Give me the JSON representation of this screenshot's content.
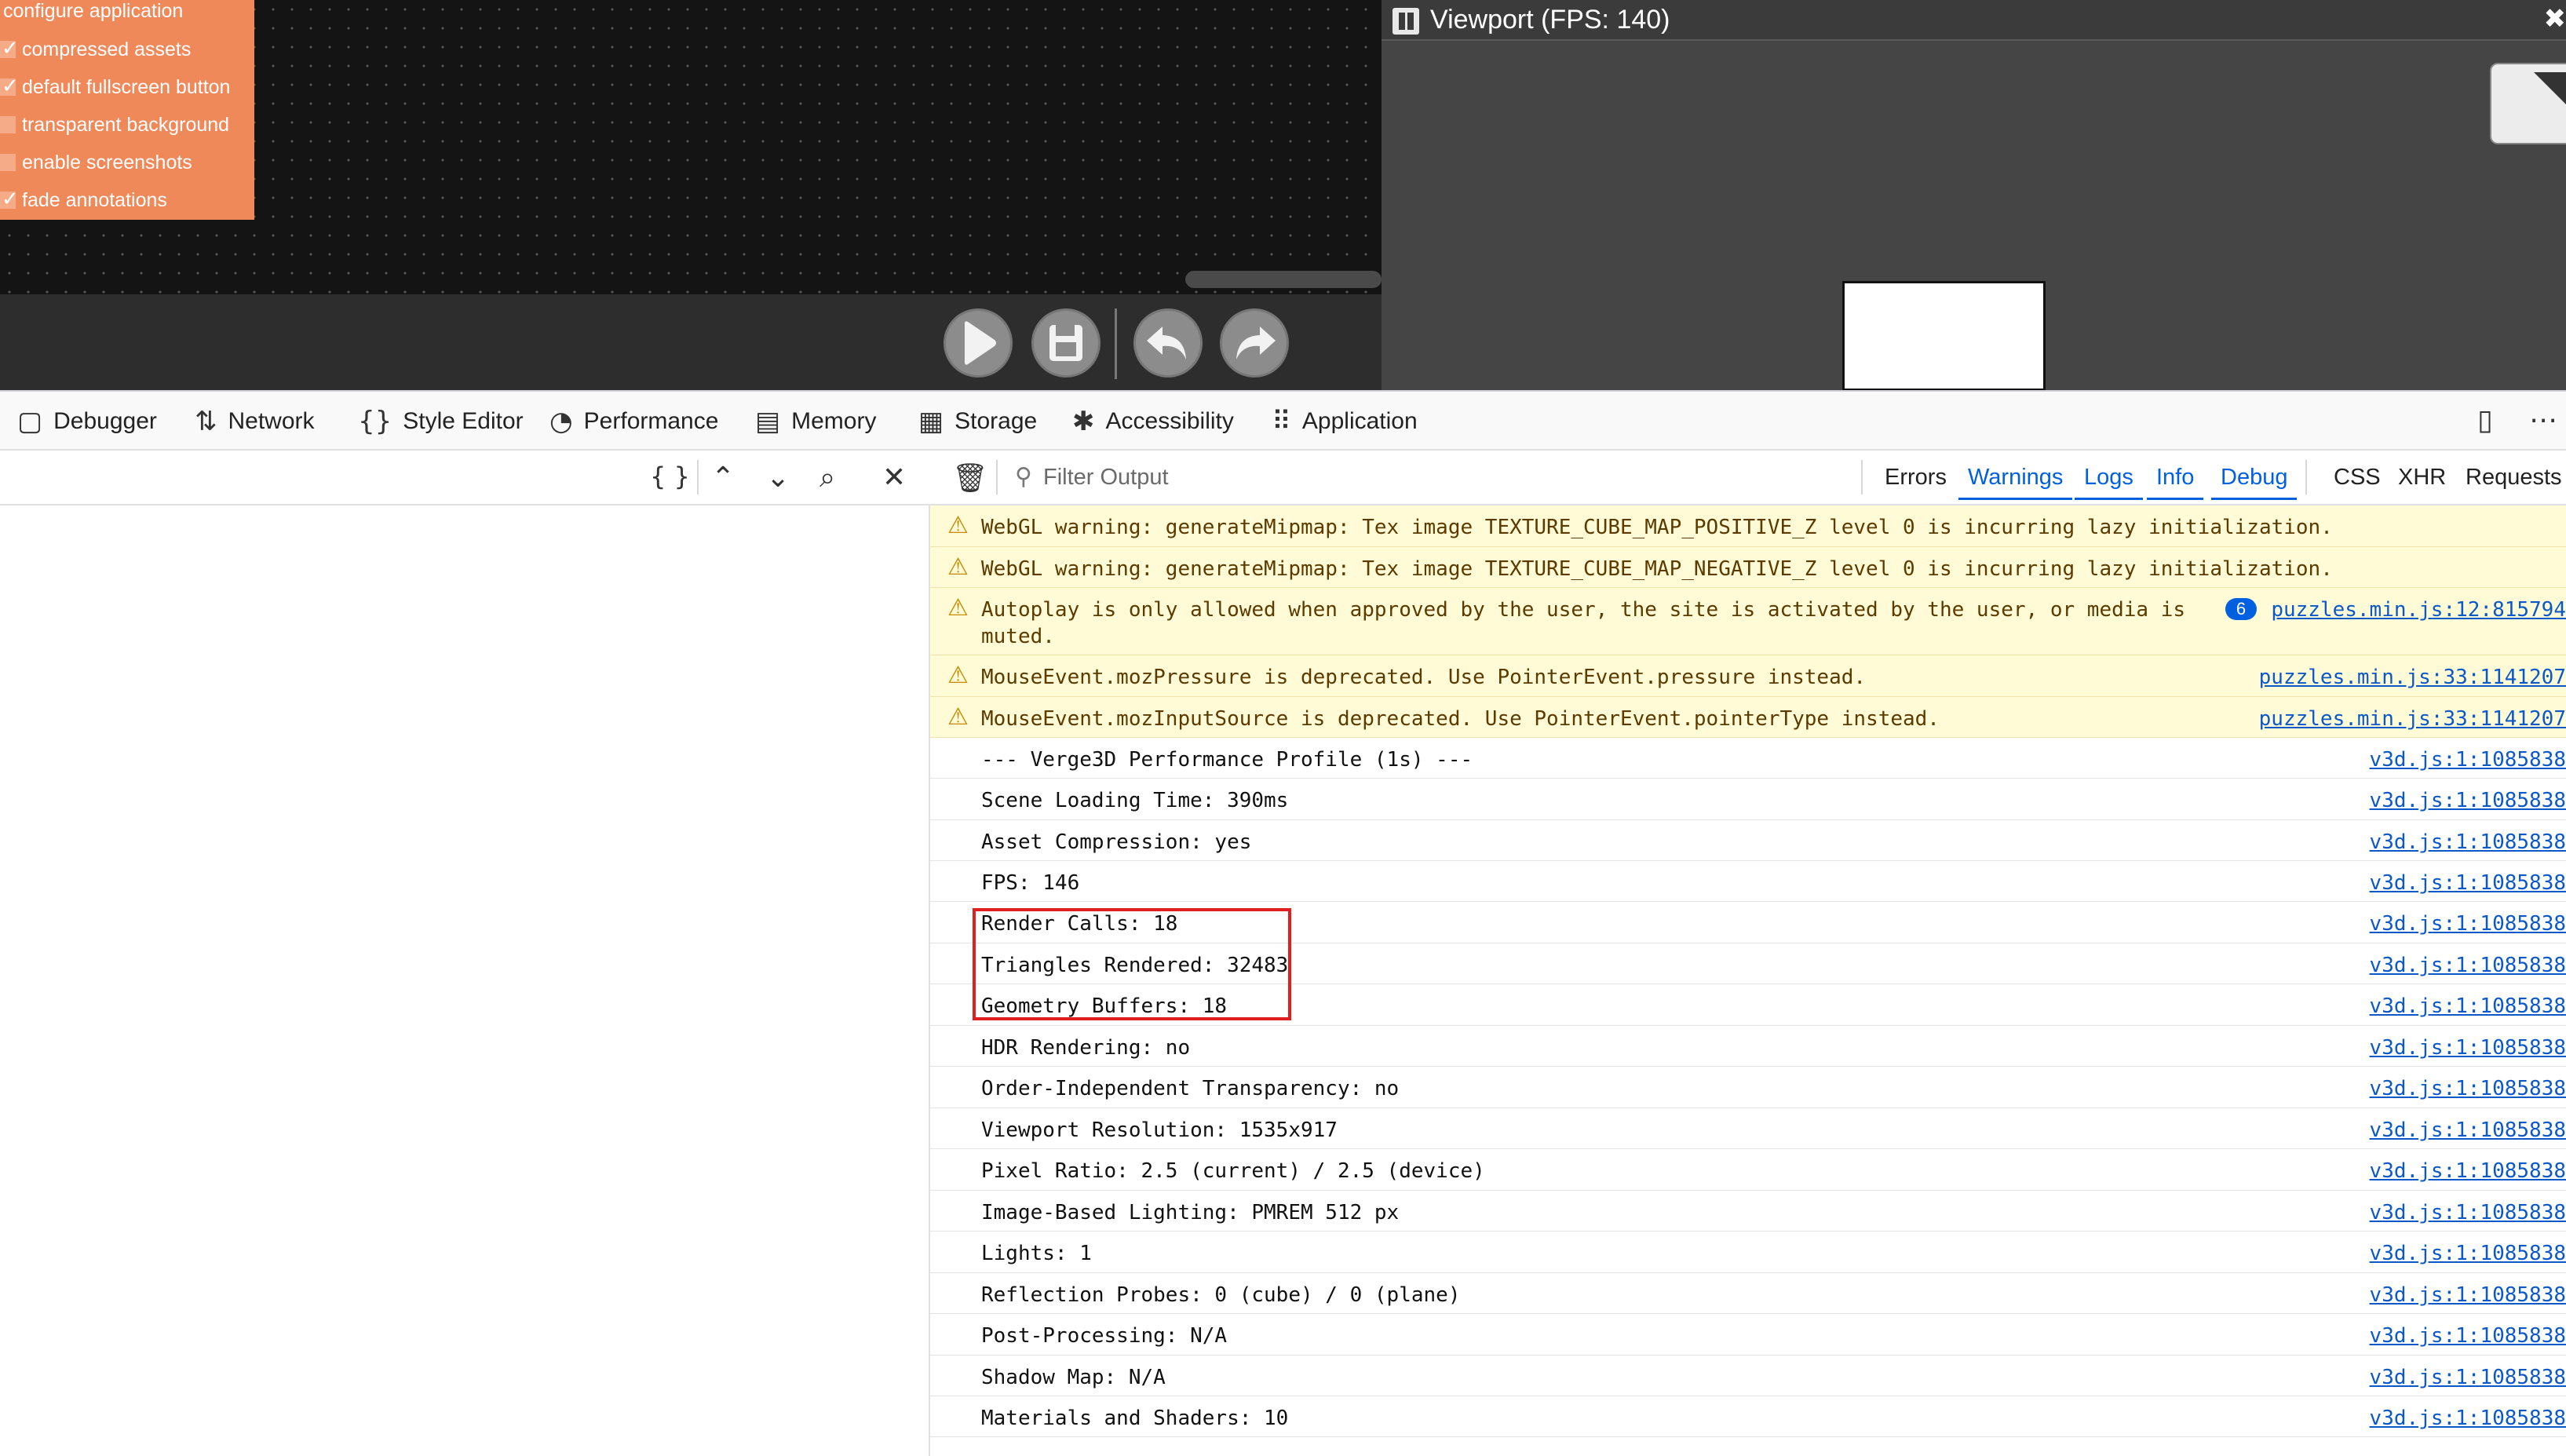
{
  "editor": {
    "config_menu": {
      "title": "configure application",
      "items": [
        {
          "label": "compressed assets",
          "checked": true
        },
        {
          "label": "default fullscreen button",
          "checked": true
        },
        {
          "label": "transparent background",
          "checked": false
        },
        {
          "label": "enable screenshots",
          "checked": false
        },
        {
          "label": "fade annotations",
          "checked": true
        }
      ]
    },
    "toolbar": {
      "icons": [
        "play-icon",
        "save-icon",
        "undo-icon",
        "redo-icon"
      ]
    }
  },
  "viewport": {
    "title": "Viewport (FPS: 140)",
    "close_glyph": "✖"
  },
  "devtools": {
    "tabs": [
      {
        "label": "Debugger",
        "icon": "debugger-icon",
        "glyph": "▢"
      },
      {
        "label": "Network",
        "icon": "network-icon",
        "glyph": "⇅"
      },
      {
        "label": "Style Editor",
        "icon": "style-editor-icon",
        "glyph": "{}"
      },
      {
        "label": "Performance",
        "icon": "performance-icon",
        "glyph": "◔"
      },
      {
        "label": "Memory",
        "icon": "memory-icon",
        "glyph": "▤"
      },
      {
        "label": "Storage",
        "icon": "storage-icon",
        "glyph": "▦"
      },
      {
        "label": "Accessibility",
        "icon": "accessibility-icon",
        "glyph": "✱"
      },
      {
        "label": "Application",
        "icon": "application-icon",
        "glyph": "⠿"
      }
    ],
    "left_toolbar": {
      "pretty_print": "{ }"
    },
    "console": {
      "filter_placeholder": "Filter Output",
      "filters": [
        {
          "label": "Errors",
          "active": false
        },
        {
          "label": "Warnings",
          "active": true
        },
        {
          "label": "Logs",
          "active": true
        },
        {
          "label": "Info",
          "active": true
        },
        {
          "label": "Debug",
          "active": true
        }
      ],
      "extra_filters": [
        "CSS",
        "XHR",
        "Requests"
      ],
      "messages": [
        {
          "type": "warning",
          "text": "WebGL warning: generateMipmap: Tex image TEXTURE_CUBE_MAP_POSITIVE_Z level 0 is incurring lazy initialization.",
          "source": ""
        },
        {
          "type": "warning",
          "text": "WebGL warning: generateMipmap: Tex image TEXTURE_CUBE_MAP_NEGATIVE_Z level 0 is incurring lazy initialization.",
          "source": ""
        },
        {
          "type": "warning",
          "text": "Autoplay is only allowed when approved by the user, the site is activated by the user, or media is\nmuted.",
          "source": "puzzles.min.js:12:815794",
          "count": "6"
        },
        {
          "type": "warning",
          "text": "MouseEvent.mozPressure is deprecated. Use PointerEvent.pressure instead.",
          "source": "puzzles.min.js:33:1141207"
        },
        {
          "type": "warning",
          "text": "MouseEvent.mozInputSource is deprecated. Use PointerEvent.pointerType instead.",
          "source": "puzzles.min.js:33:1141207"
        },
        {
          "type": "log",
          "text": "--- Verge3D Performance Profile (1s) ---",
          "source": "v3d.js:1:1085838"
        },
        {
          "type": "log",
          "text": "Scene Loading Time: 390ms",
          "source": "v3d.js:1:1085838"
        },
        {
          "type": "log",
          "text": "Asset Compression: yes",
          "source": "v3d.js:1:1085838"
        },
        {
          "type": "log",
          "text": "FPS: 146",
          "source": "v3d.js:1:1085838"
        },
        {
          "type": "log",
          "text": "Render Calls: 18",
          "source": "v3d.js:1:1085838"
        },
        {
          "type": "log",
          "text": "Triangles Rendered: 32483",
          "source": "v3d.js:1:1085838"
        },
        {
          "type": "log",
          "text": "Geometry Buffers: 18",
          "source": "v3d.js:1:1085838"
        },
        {
          "type": "log",
          "text": "HDR Rendering: no",
          "source": "v3d.js:1:1085838"
        },
        {
          "type": "log",
          "text": "Order-Independent Transparency: no",
          "source": "v3d.js:1:1085838"
        },
        {
          "type": "log",
          "text": "Viewport Resolution: 1535x917",
          "source": "v3d.js:1:1085838"
        },
        {
          "type": "log",
          "text": "Pixel Ratio: 2.5 (current) / 2.5 (device)",
          "source": "v3d.js:1:1085838"
        },
        {
          "type": "log",
          "text": "Image-Based Lighting: PMREM 512 px",
          "source": "v3d.js:1:1085838"
        },
        {
          "type": "log",
          "text": "Lights: 1",
          "source": "v3d.js:1:1085838"
        },
        {
          "type": "log",
          "text": "Reflection Probes: 0 (cube) / 0 (plane)",
          "source": "v3d.js:1:1085838"
        },
        {
          "type": "log",
          "text": "Post-Processing: N/A",
          "source": "v3d.js:1:1085838"
        },
        {
          "type": "log",
          "text": "Shadow Map: N/A",
          "source": "v3d.js:1:1085838"
        },
        {
          "type": "log",
          "text": "Materials and Shaders: 10",
          "source": "v3d.js:1:1085838"
        }
      ]
    }
  },
  "colors": {
    "accent": "#0060df",
    "warning_bg": "#fffbd6",
    "config_menu": "#f0895a",
    "highlight": "#e02020"
  }
}
